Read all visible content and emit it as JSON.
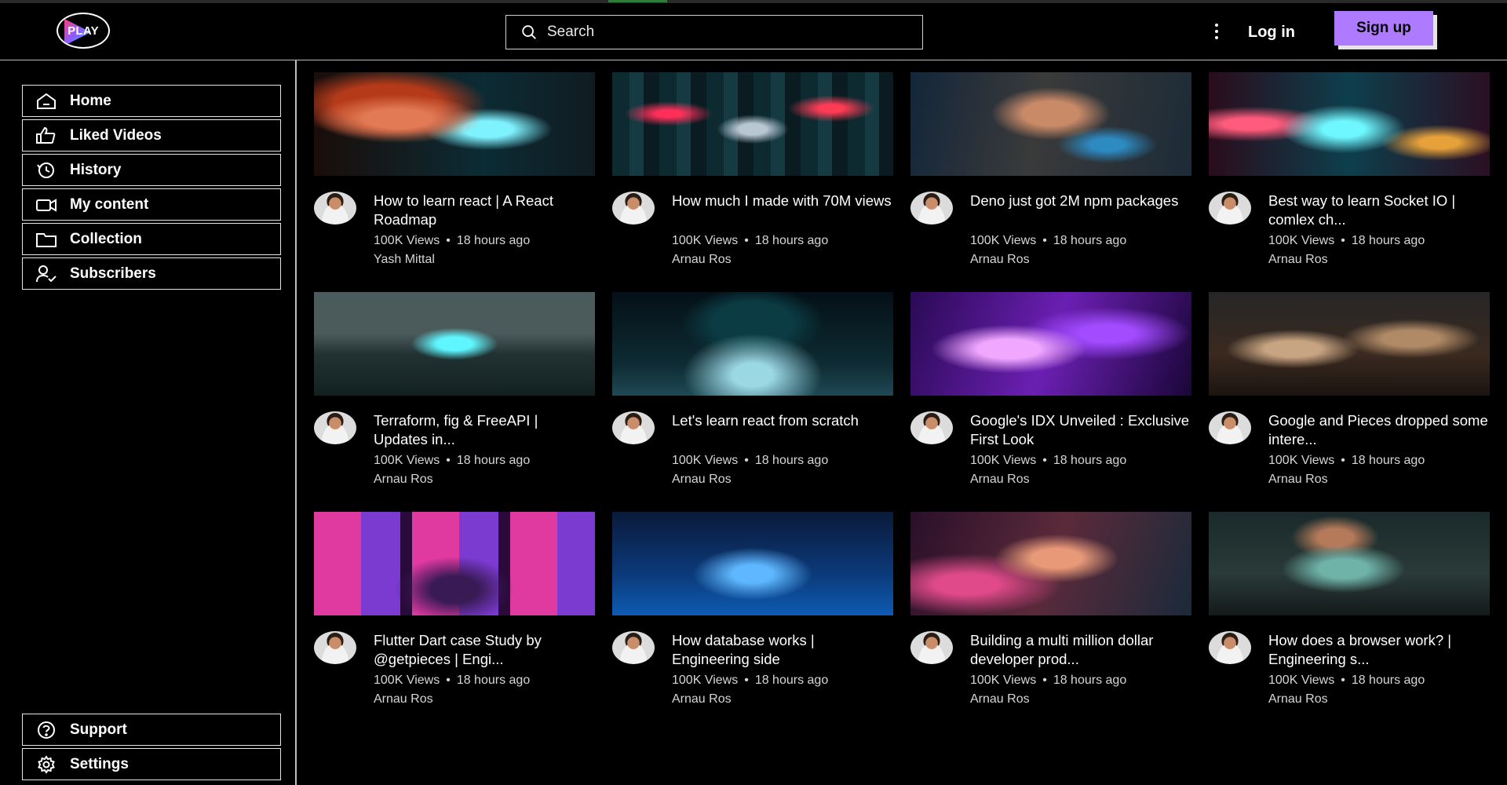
{
  "header": {
    "logo_text": "PLAY",
    "search": {
      "placeholder": "Search",
      "icon": "search-icon"
    },
    "more_icon": "kebab-icon",
    "login_label": "Log in",
    "signup_label": "Sign up"
  },
  "sidebar": {
    "items": [
      {
        "label": "Home",
        "icon": "home-icon"
      },
      {
        "label": "Liked Videos",
        "icon": "thumbs-up-icon"
      },
      {
        "label": "History",
        "icon": "history-icon"
      },
      {
        "label": "My content",
        "icon": "video-icon"
      },
      {
        "label": "Collection",
        "icon": "folder-icon"
      },
      {
        "label": "Subscribers",
        "icon": "user-check-icon"
      }
    ],
    "bottom_items": [
      {
        "label": "Support",
        "icon": "help-icon"
      },
      {
        "label": "Settings",
        "icon": "gear-icon"
      }
    ]
  },
  "videos": [
    {
      "title": "How to learn react | A React Roadmap",
      "views": "100K Views",
      "age": "18 hours ago",
      "author": "Yash Mittal"
    },
    {
      "title": "How much I made with 70M views",
      "views": "100K Views",
      "age": "18 hours ago",
      "author": "Arnau Ros"
    },
    {
      "title": "Deno just got 2M npm packages",
      "views": "100K Views",
      "age": "18 hours ago",
      "author": "Arnau Ros"
    },
    {
      "title": "Best way to learn Socket IO | comlex ch...",
      "views": "100K Views",
      "age": "18 hours ago",
      "author": "Arnau Ros"
    },
    {
      "title": "Terraform, fig & FreeAPI | Updates in...",
      "views": "100K Views",
      "age": "18 hours ago",
      "author": "Arnau Ros"
    },
    {
      "title": "Let's learn react from scratch",
      "views": "100K Views",
      "age": "18 hours ago",
      "author": "Arnau Ros"
    },
    {
      "title": "Google's IDX Unveiled : Exclusive First Look",
      "views": "100K Views",
      "age": "18 hours ago",
      "author": "Arnau Ros"
    },
    {
      "title": "Google and Pieces dropped some intere...",
      "views": "100K Views",
      "age": "18 hours ago",
      "author": "Arnau Ros"
    },
    {
      "title": "Flutter Dart case Study by @getpieces | Engi...",
      "views": "100K Views",
      "age": "18 hours ago",
      "author": "Arnau Ros"
    },
    {
      "title": "How database works | Engineering side",
      "views": "100K Views",
      "age": "18 hours ago",
      "author": "Arnau Ros"
    },
    {
      "title": "Building a multi million dollar developer prod...",
      "views": "100K Views",
      "age": "18 hours ago",
      "author": "Arnau Ros"
    },
    {
      "title": "How does a browser work? | Engineering s...",
      "views": "100K Views",
      "age": "18 hours ago",
      "author": "Arnau Ros"
    }
  ],
  "stats_separator": "•",
  "colors": {
    "accent": "#ae7aff",
    "background": "#000000",
    "border": "#e6e6e6",
    "text_muted": "#d6d6d6"
  }
}
